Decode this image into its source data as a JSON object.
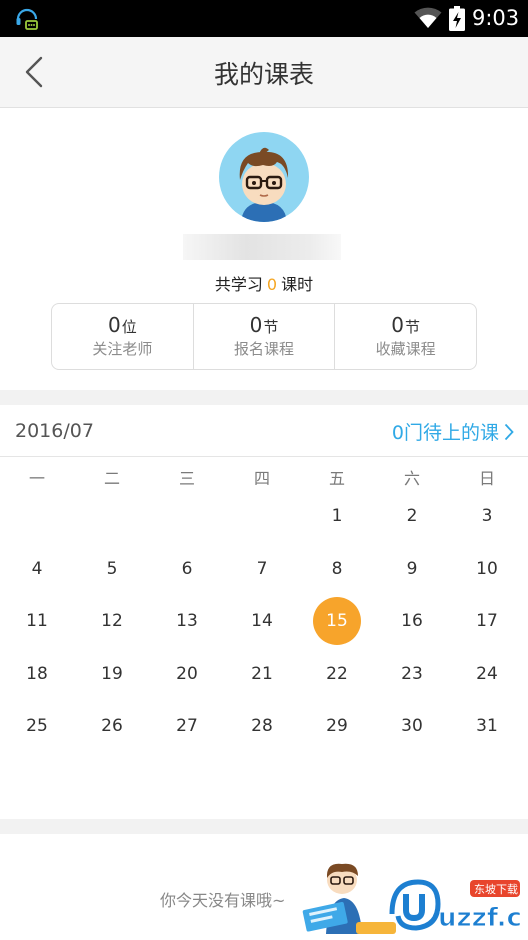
{
  "status_bar": {
    "time": "9:03"
  },
  "header": {
    "title": "我的课表"
  },
  "profile": {
    "studied_prefix": "共学习",
    "studied_hours": "0",
    "studied_suffix": "课时",
    "stats": [
      {
        "value": "0",
        "unit": "位",
        "label": "关注老师"
      },
      {
        "value": "0",
        "unit": "节",
        "label": "报名课程"
      },
      {
        "value": "0",
        "unit": "节",
        "label": "收藏课程"
      }
    ]
  },
  "calendar": {
    "month": "2016/07",
    "upcoming_link": "0门待上的课",
    "weekdays": [
      "一",
      "二",
      "三",
      "四",
      "五",
      "六",
      "日"
    ],
    "first_weekday_index": 4,
    "days_in_month": 31,
    "today": "15",
    "today_color": "#f7a42b"
  },
  "empty_state": {
    "message": "你今天没有课哦~"
  },
  "watermark": {
    "text": "uzzf.com",
    "tag": "东坡下载"
  },
  "colors": {
    "accent_blue": "#30a9e6",
    "accent_orange": "#f5a623"
  }
}
